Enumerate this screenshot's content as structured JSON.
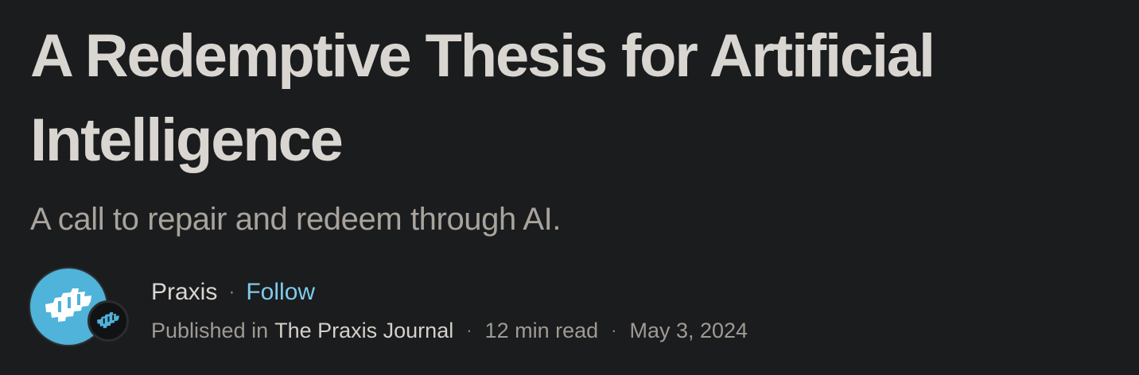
{
  "article": {
    "title": "A Redemptive Thesis for Artificial Intelligence",
    "subtitle": "A call to repair and redeem through AI."
  },
  "byline": {
    "author_name": "Praxis",
    "separator": "·",
    "follow_label": "Follow",
    "published_in_label": "Published in",
    "publication_name": "The Praxis Journal",
    "read_time": "12 min read",
    "date": "May 3, 2024"
  },
  "icons": {
    "author_avatar": "praxis-logo-icon",
    "publication_badge": "praxis-journal-logo-icon"
  },
  "colors": {
    "background": "#1b1c1e",
    "title": "#d9d6d1",
    "subtitle": "#a8a39c",
    "follow_accent": "#7ecbeb",
    "avatar_blue": "#4fb3da"
  }
}
